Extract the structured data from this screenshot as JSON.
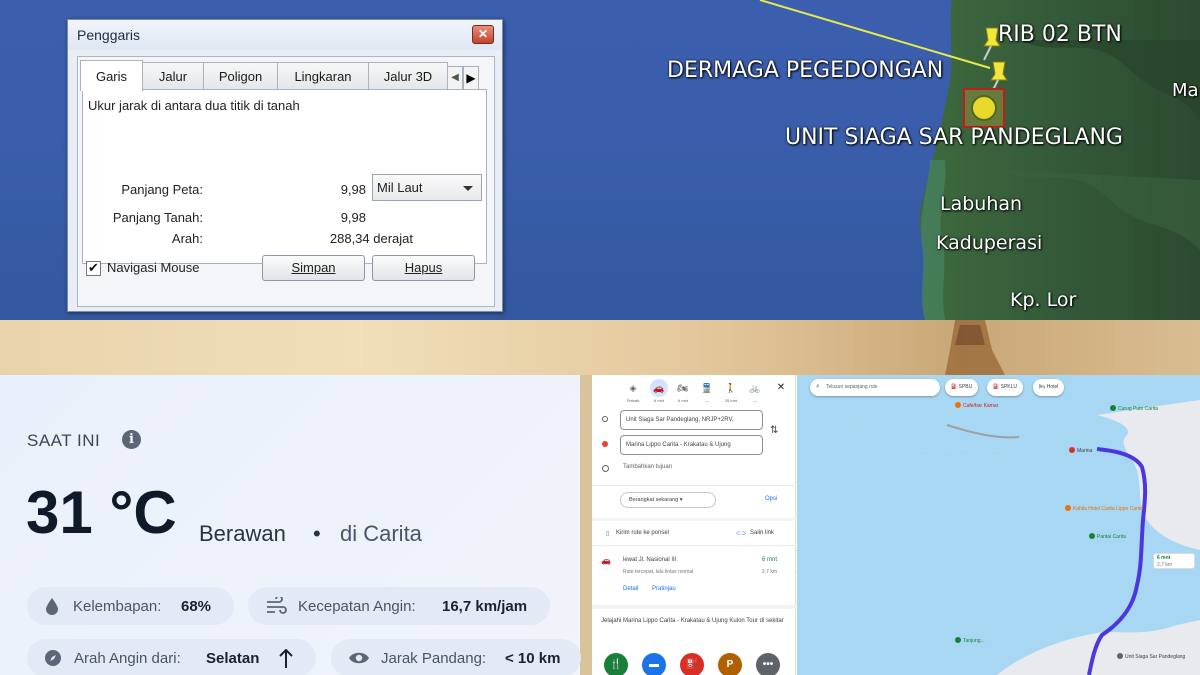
{
  "satellite": {
    "labels": {
      "rib": "RIB 02 BTN",
      "dermaga": "DERMAGA PEGEDONGAN",
      "unit": "UNIT SIAGA SAR PANDEGLANG",
      "ma": "Ma",
      "labuhan": "Labuhan",
      "kaduperasi": "Kaduperasi",
      "kplor": "Kp. Lor"
    },
    "colors": {
      "sea": "#3a5eab",
      "land": "#3f6b3f",
      "path": "#e8e84a"
    }
  },
  "ruler": {
    "title": "Penggaris",
    "close": "✕",
    "tabs": [
      "Garis",
      "Jalur",
      "Poligon",
      "Lingkaran",
      "Jalur 3D"
    ],
    "active_tab": "Garis",
    "nav_prev": "◀",
    "nav_next": "▶",
    "description": "Ukur jarak di antara dua titik di tanah",
    "map_length_label": "Panjang Peta:",
    "map_length_value": "9,98",
    "unit_selected": "Mil Laut",
    "ground_length_label": "Panjang Tanah:",
    "ground_length_value": "9,98",
    "heading_label": "Arah:",
    "heading_value": "288,34 derajat",
    "mouse_nav_label": "Navigasi Mouse",
    "mouse_nav_checked": "✔",
    "save_label": "Simpan",
    "delete_label": "Hapus"
  },
  "weather": {
    "now_label": "SAAT INI",
    "info": "i",
    "temperature": "31 °C",
    "condition": "Berawan",
    "separator": "•",
    "location": "di Carita",
    "humidity_label": "Kelembapan:",
    "humidity_value": "68%",
    "wind_speed_label": "Kecepatan Angin:",
    "wind_speed_value": "16,7 km/jam",
    "wind_dir_label": "Arah Angin dari:",
    "wind_dir_value": "Selatan",
    "visibility_label": "Jarak Pandang:",
    "visibility_value": "< 10 km"
  },
  "maps": {
    "modes": [
      {
        "icon": "◈",
        "sub": "Terbaik"
      },
      {
        "icon": "🚗",
        "sub": "6 mnt"
      },
      {
        "icon": "🏍",
        "sub": "6 mnt"
      },
      {
        "icon": "🚆",
        "sub": "—"
      },
      {
        "icon": "🚶",
        "sub": "35 mnt"
      },
      {
        "icon": "🚲",
        "sub": "—"
      }
    ],
    "close": "✕",
    "origin": "Unit Siaga Sar Pandeglang, NRJP+2RV,",
    "destination": "Marina Lippo Carita - Krakatau & Ujung",
    "add_destination": "Tambahkan tujuan",
    "swap": "⇅",
    "depart_label": "Berangkat sekarang ▾",
    "options_label": "Opsi",
    "send_label": "Kirim rute ke ponsel",
    "copy_link_label": "Salin link",
    "route_name": "lewat Jl. Nasional III",
    "route_time": "6 mnt",
    "route_note": "Rute tercepat, lalu lintas normal",
    "route_distance": "2,7 km",
    "detail_label": "Detail",
    "preview_label": "Pratinjau",
    "explore_text": "Jelajahi Marina Lippo Carita - Krakatau & Ujung Kulon Tour di sekitar",
    "collapse": "◂",
    "search_placeholder": "Telusuri sepanjang rute",
    "chips": [
      "⛽ SPBU",
      "⛽ SPKLU",
      "🛏 Hotel"
    ],
    "pois": {
      "cafe": "Cafe/bar Kamar",
      "curug": "Curug Putri Carita",
      "marina": "Marina",
      "hotel_carita": "Kahila Hotel Carita Lippo Carita",
      "pantai": "Pantai Carita",
      "unit": "Unit Siaga Sar Pandeglang",
      "tanjung": "Tanjung..."
    },
    "route_badge_time": "6 mnt",
    "route_badge_dist": "2,7 km",
    "colors": {
      "water": "#a8d7f3",
      "land": "#e8eaed",
      "route": "#4a37e0"
    }
  }
}
